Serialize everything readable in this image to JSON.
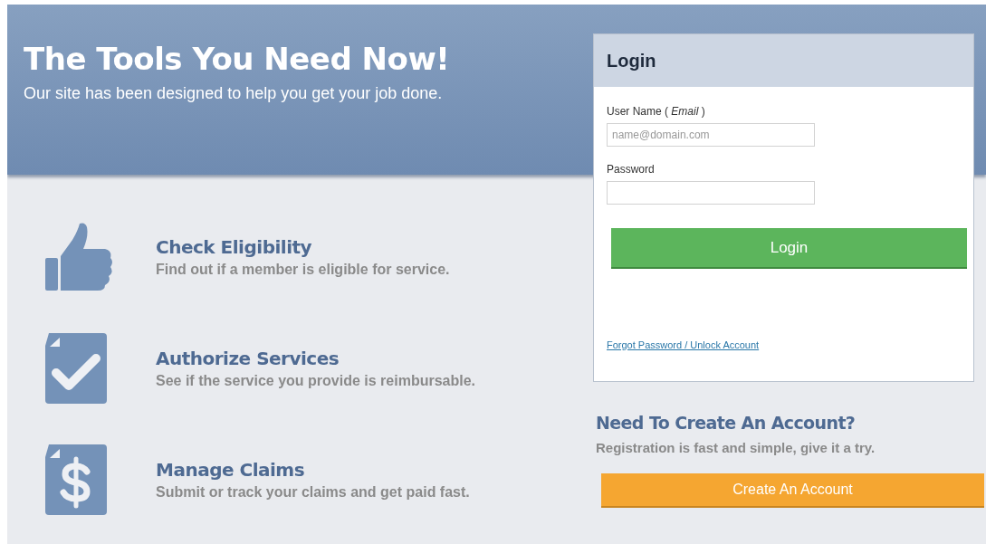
{
  "hero": {
    "title": "The Tools You Need Now!",
    "subtitle": "Our site has been designed to help you get your job done."
  },
  "features": [
    {
      "kind": "thumbs-up",
      "title": "Check Eligibility",
      "description": "Find out if a member is eligible for service."
    },
    {
      "kind": "checkmark",
      "title": "Authorize Services",
      "description": "See if the service you provide is reimbursable."
    },
    {
      "kind": "dollar",
      "title": "Manage Claims",
      "description": "Submit or track your claims and get paid fast."
    }
  ],
  "login": {
    "title": "Login",
    "username_label": "User Name  ( *Email* )",
    "username_placeholder": "name@domain.com",
    "password_label": "Password",
    "button": "Login",
    "forgot_link": "Forgot Password / Unlock Account"
  },
  "register": {
    "title": "Need To Create An Account?",
    "text": "Registration is fast and simple, give it a try.",
    "button": "Create An Account"
  }
}
